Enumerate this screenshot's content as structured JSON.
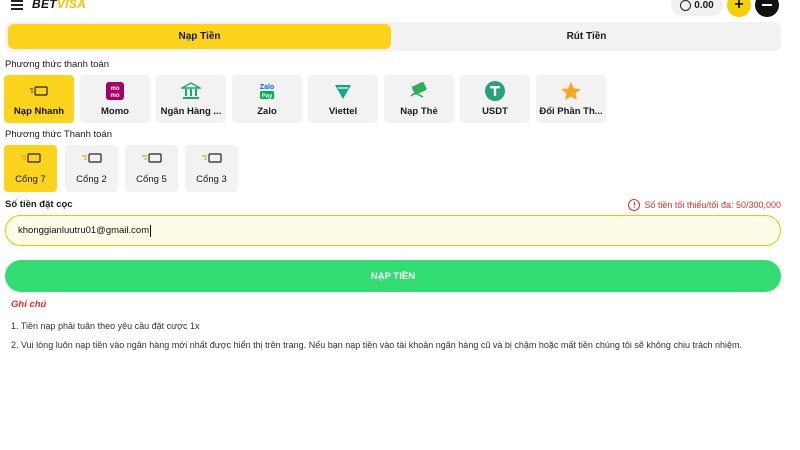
{
  "header": {
    "logo_bet": "BET",
    "logo_visa": "VISA",
    "balance": "0.00",
    "plus": "+"
  },
  "tabs": [
    {
      "label": "Nạp Tiền",
      "active": true
    },
    {
      "label": "Rút Tiền",
      "active": false
    }
  ],
  "payment_method_label": "Phương thức thanh toán",
  "payment_methods": [
    {
      "label": "Nạp Nhanh",
      "icon": "card-icon",
      "active": true
    },
    {
      "label": "Momo",
      "icon": "momo-icon"
    },
    {
      "label": "Ngân Hàng ...",
      "icon": "bank-icon"
    },
    {
      "label": "Zalo",
      "icon": "zalopay-icon"
    },
    {
      "label": "Viettel",
      "icon": "viettel-icon"
    },
    {
      "label": "Nạp Thẻ",
      "icon": "phone-card-icon"
    },
    {
      "label": "USDT",
      "icon": "usdt-icon"
    },
    {
      "label": "Đổi Phần Th...",
      "icon": "star-icon"
    }
  ],
  "gateway_label": "Phương thức Thanh toán",
  "gateways": [
    {
      "label": "Cổng 7",
      "active": true
    },
    {
      "label": "Cổng 2"
    },
    {
      "label": "Cổng 5"
    },
    {
      "label": "Cổng 3"
    }
  ],
  "amount": {
    "label": "Số tiền đặt cọc",
    "limit_text": "Số tiền tối thiểu/tối đa: 50/300,000",
    "value": "khonggianluutru01@gmail.com"
  },
  "submit_label": "NẠP TIỀN",
  "notes": {
    "title": "Ghi chú",
    "lines": [
      "1. Tiền nạp phải tuân theo yêu cầu đặt cược 1x",
      "2. Vui lòng luôn nạp tiền vào ngân hàng mới nhất được hiển thị trên trang. Nếu bạn nạp tiền vào tài khoản ngân hàng cũ và bị chậm hoặc mất tiền chúng tôi sẽ không chịu trách nhiệm."
    ]
  },
  "colors": {
    "accent_yellow": "#fcd31d",
    "submit_green": "#33dc73",
    "warning_red": "#e12d2d"
  }
}
